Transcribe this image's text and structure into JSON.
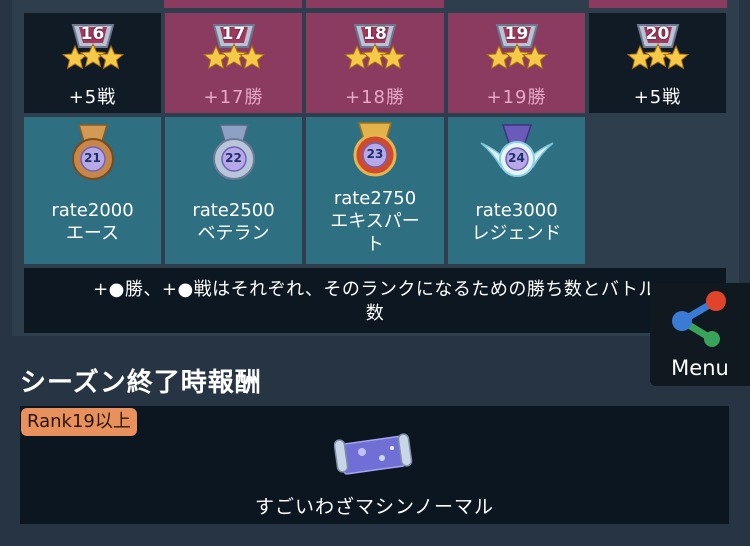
{
  "rank_tiers": [
    {
      "rank": "16",
      "label": "+5戦"
    },
    {
      "rank": "17",
      "label": "+17勝"
    },
    {
      "rank": "18",
      "label": "+18勝"
    },
    {
      "rank": "19",
      "label": "+19勝"
    },
    {
      "rank": "20",
      "label": "+5戦"
    }
  ],
  "rate_tiers": [
    {
      "rank": "21",
      "line1": "rate2000",
      "line2": "エース",
      "line3": ""
    },
    {
      "rank": "22",
      "line1": "rate2500",
      "line2": "ベテラン",
      "line3": ""
    },
    {
      "rank": "23",
      "line1": "rate2750",
      "line2": "エキスパー",
      "line3": "ト"
    },
    {
      "rank": "24",
      "line1": "rate3000",
      "line2": "レジェンド",
      "line3": ""
    }
  ],
  "note": {
    "line1": "+●勝、+●戦はそれぞれ、そのランクになるための勝ち数とバトル",
    "line2": "数"
  },
  "season_reward": {
    "title": "シーズン終了時報酬",
    "rank_requirement": "Rank19以上",
    "item_name": "すごいわざマシンノーマル",
    "item_icon": "tm-scroll-icon"
  },
  "menu": {
    "label": "Menu",
    "icon": "share-icon"
  },
  "colors": {
    "background": "#273443",
    "dark_cell": "#101b26",
    "pink_cell": "#8b3a60",
    "teal_cell": "#2f6f82",
    "pill": "#e8915d"
  }
}
